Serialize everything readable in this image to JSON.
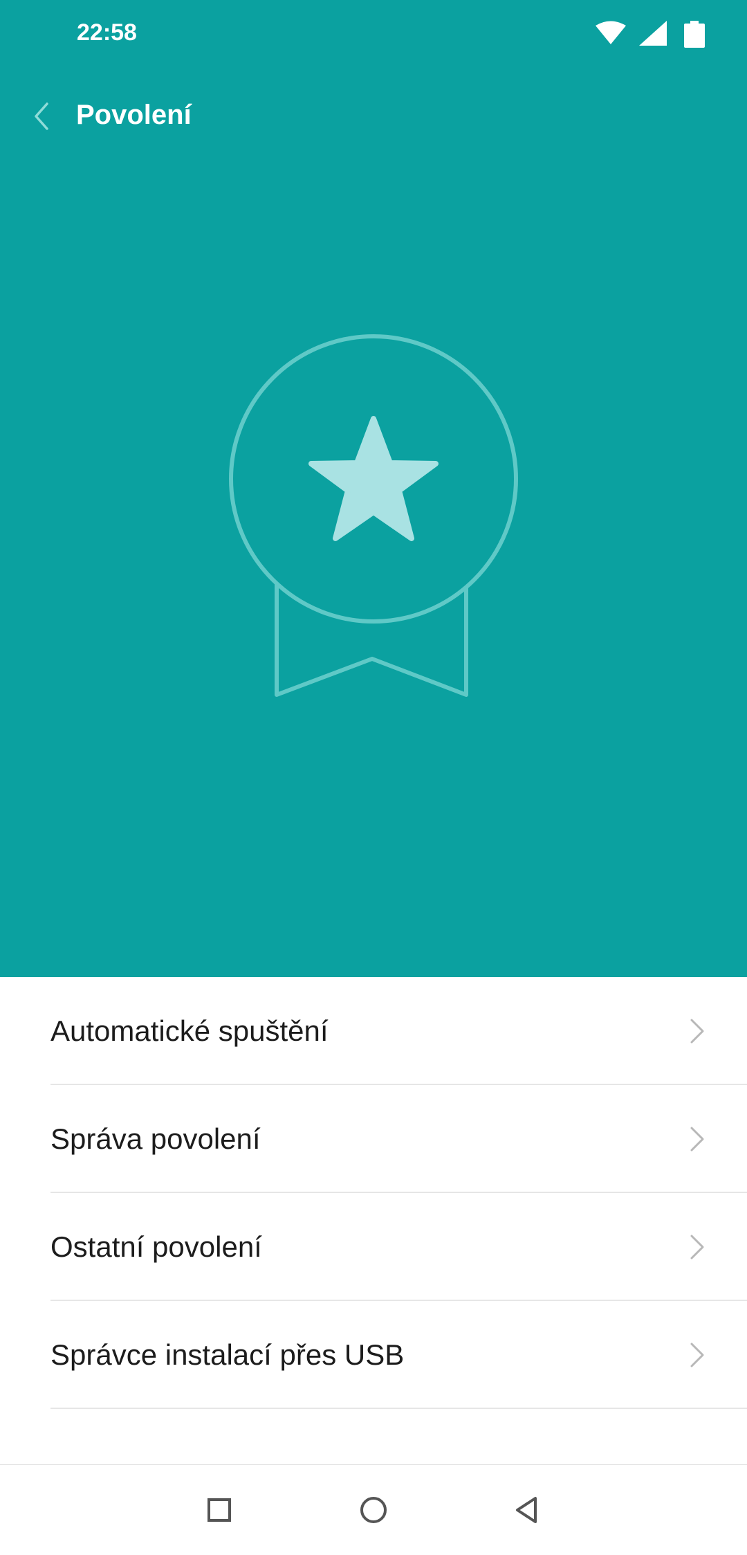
{
  "status_bar": {
    "time": "22:58",
    "icons": [
      "wifi-icon",
      "signal-icon",
      "battery-icon"
    ]
  },
  "header": {
    "title": "Povolení",
    "back_icon": "chevron-left-icon"
  },
  "colors": {
    "header_background": "#0ba1a0",
    "badge_outline": "#5fc9c7",
    "badge_star": "#a9e2e3",
    "list_text": "#1c1c1c",
    "chevron": "#b8b8b8"
  },
  "hero_icon": "award-badge-star-icon",
  "list": {
    "items": [
      {
        "label": "Automatické spuštění",
        "icon": "chevron-right-icon"
      },
      {
        "label": "Správa povolení",
        "icon": "chevron-right-icon"
      },
      {
        "label": "Ostatní povolení",
        "icon": "chevron-right-icon"
      },
      {
        "label": "Správce instalací přes USB",
        "icon": "chevron-right-icon"
      }
    ]
  },
  "nav_bar": {
    "buttons": [
      "recent-apps-icon",
      "home-icon",
      "back-icon"
    ]
  }
}
